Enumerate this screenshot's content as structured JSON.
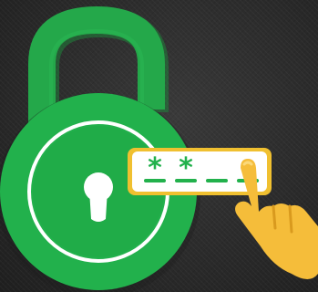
{
  "password_display": {
    "entered_chars": [
      "*",
      "*"
    ],
    "total_slots": 4,
    "mask_char": "*"
  },
  "colors": {
    "background": "#2b2b2b",
    "lock_green": "#22b14c",
    "shackle_green": "#24a84a",
    "field_border": "#f0c030",
    "field_fill": "#ffffff",
    "hand_yellow": "#f5bd3a",
    "hand_shadow": "#d99a1e",
    "keyhole": "#ffffff"
  },
  "icons": {
    "lock": "padlock-icon",
    "keyhole": "keyhole-icon",
    "hand": "pointing-hand-icon"
  }
}
